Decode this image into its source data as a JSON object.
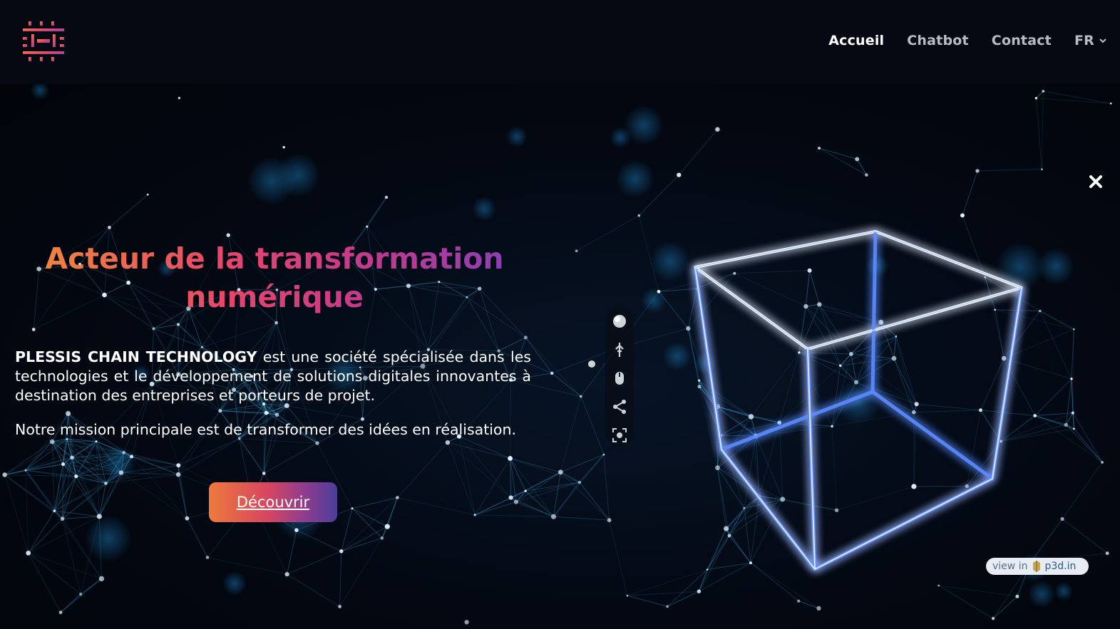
{
  "header": {
    "logo_alt": "Plessis Chain Technology logo",
    "nav": [
      {
        "label": "Accueil",
        "active": true
      },
      {
        "label": "Chatbot",
        "active": false
      },
      {
        "label": "Contact",
        "active": false
      }
    ],
    "language": "FR"
  },
  "hero": {
    "headline_line1": "Acteur de la transformation",
    "headline_line2": "numérique",
    "company_name": "PLESSIS CHAIN TECHNOLOGY",
    "intro_rest": " est une société spécialisée dans les technologies et le développement de solutions digitales innovantes à destination des entreprises et porteurs de projet.",
    "mission": "Notre mission principale est de transformer des idées en réalisation.",
    "cta_label": "Découvrir"
  },
  "viewer": {
    "badge_view_in": "view in",
    "badge_site": "p3d.in",
    "tools": [
      "lighting-icon",
      "pin-icon",
      "mouse-icon",
      "share-icon",
      "fullscreen-icon"
    ]
  },
  "colors": {
    "background": "#05060c",
    "header": "#060912",
    "accent_orange": "#f08a3c",
    "accent_pink": "#e8466a",
    "accent_purple": "#8a3fb5",
    "cube_glow": "#3f7dff",
    "network": "#2aa3d8"
  }
}
